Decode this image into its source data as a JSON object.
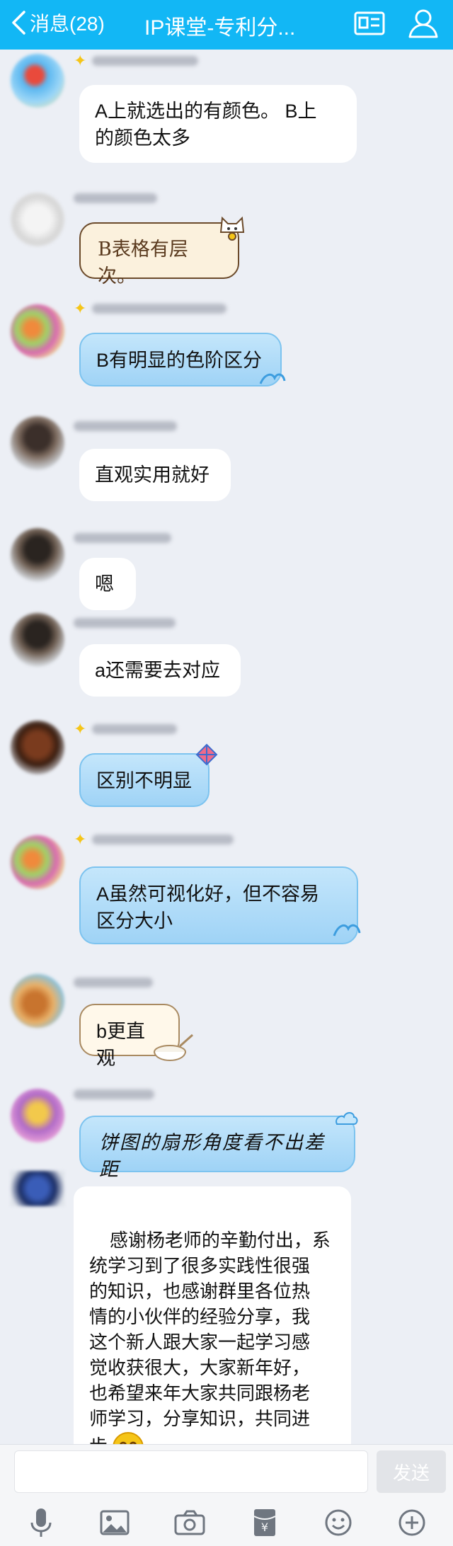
{
  "header": {
    "back_label": "消息(28)",
    "title": "IP课堂-专利分...",
    "icons": [
      "chevron-left-icon",
      "profile-card-icon",
      "user-icon"
    ],
    "background": "#12b7f5"
  },
  "messages": [
    {
      "bubble_style": "white",
      "text": "A上就选出的有颜色。 B上\n的颜色太多"
    },
    {
      "bubble_style": "beige",
      "text": "B表格有层次。"
    },
    {
      "bubble_style": "blue",
      "text": "B有明显的色阶区分"
    },
    {
      "bubble_style": "white",
      "text": "直观实用就好"
    },
    {
      "bubble_style": "white",
      "text": "嗯"
    },
    {
      "bubble_style": "white",
      "text": "a还需要去对应"
    },
    {
      "bubble_style": "blue",
      "text": "区别不明显"
    },
    {
      "bubble_style": "blue",
      "text": "A虽然可视化好，但不容易\n区分大小"
    },
    {
      "bubble_style": "lightbeige",
      "text": "b更直观"
    },
    {
      "bubble_style": "blue",
      "text": "饼图的扇形角度看不出差距"
    },
    {
      "bubble_style": "white",
      "text": "感谢杨老师的辛勤付出，系\n统学习到了很多实践性很强\n的知识，也感谢群里各位热\n情的小伙伴的经验分享，我\n这个新人跟大家一起学习感\n觉收获很大，大家新年好，\n也希望来年大家共同跟杨老\n师学习，分享知识，共同进\n步"
    }
  ],
  "input": {
    "placeholder": "",
    "send_label": "发送"
  },
  "toolbar": {
    "icons": [
      "microphone-icon",
      "image-icon",
      "camera-icon",
      "red-packet-icon",
      "emoji-icon",
      "plus-icon"
    ]
  }
}
